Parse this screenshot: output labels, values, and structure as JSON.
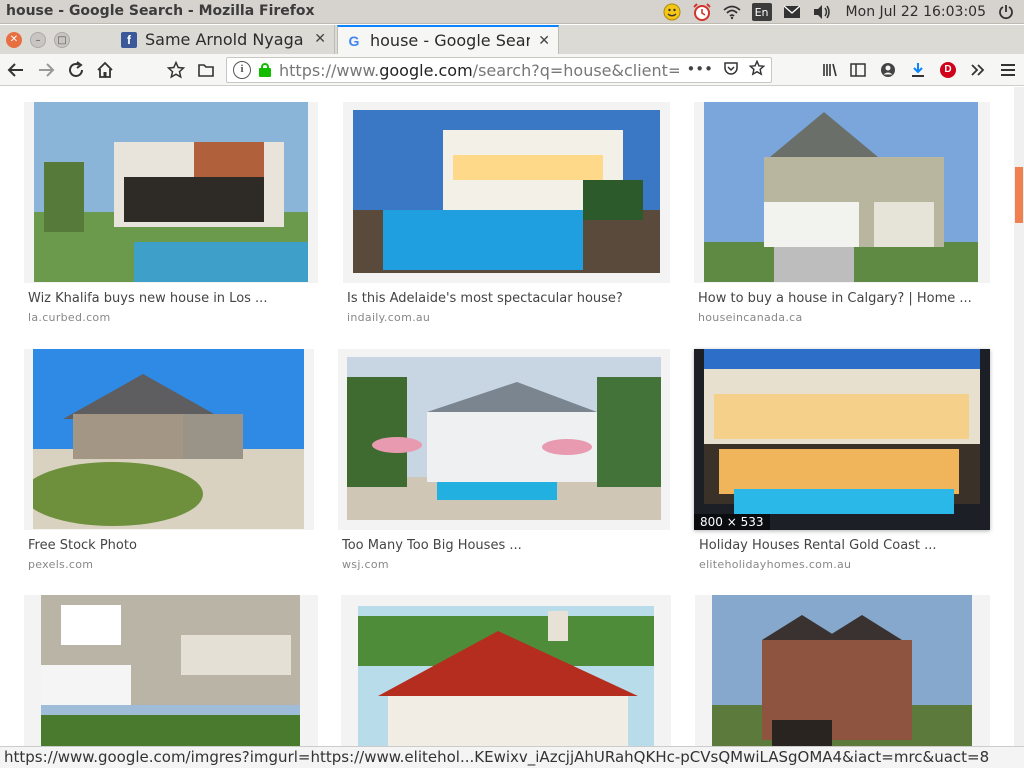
{
  "window": {
    "title": "house - Google Search - Mozilla Firefox"
  },
  "tray": {
    "keyboard": "En",
    "clock": "Mon Jul 22 16:03:05"
  },
  "tabs": [
    {
      "title": "Same Arnold Nyaga",
      "favicon": "facebook-icon"
    },
    {
      "title": "house - Google Search",
      "favicon": "google-icon"
    }
  ],
  "urlbar": {
    "url_prefix": "https://www.",
    "url_domain": "google.com",
    "url_rest": "/search?q=house&client=u",
    "more": "•••"
  },
  "results": [
    {
      "caption": "Wiz Khalifa buys new house in Los ...",
      "source": "la.curbed.com"
    },
    {
      "caption": "Is this Adelaide's most spectacular house?",
      "source": "indaily.com.au"
    },
    {
      "caption": "How to buy a house in Calgary? | Home ...",
      "source": "houseincanada.ca"
    },
    {
      "caption": "Free Stock Photo",
      "source": "pexels.com"
    },
    {
      "caption": "Too Many Too Big Houses ...",
      "source": "wsj.com"
    },
    {
      "caption": "Holiday Houses Rental Gold Coast ...",
      "source": "eliteholidayhomes.com.au",
      "dimensions": "800 × 533"
    },
    {
      "caption": "",
      "source": ""
    },
    {
      "caption": "",
      "source": ""
    },
    {
      "caption": "",
      "source": ""
    }
  ],
  "status": {
    "text": "https://www.google.com/imgres?imgurl=https://www.elitehol...KEwixv_iAzcjjAhURahQKHc-pCVsQMwiLASgOMA4&iact=mrc&uact=8"
  },
  "colors": {
    "accent": "#0a84ff",
    "scroll_thumb": "#f08050",
    "lock_green": "#12bc00"
  }
}
